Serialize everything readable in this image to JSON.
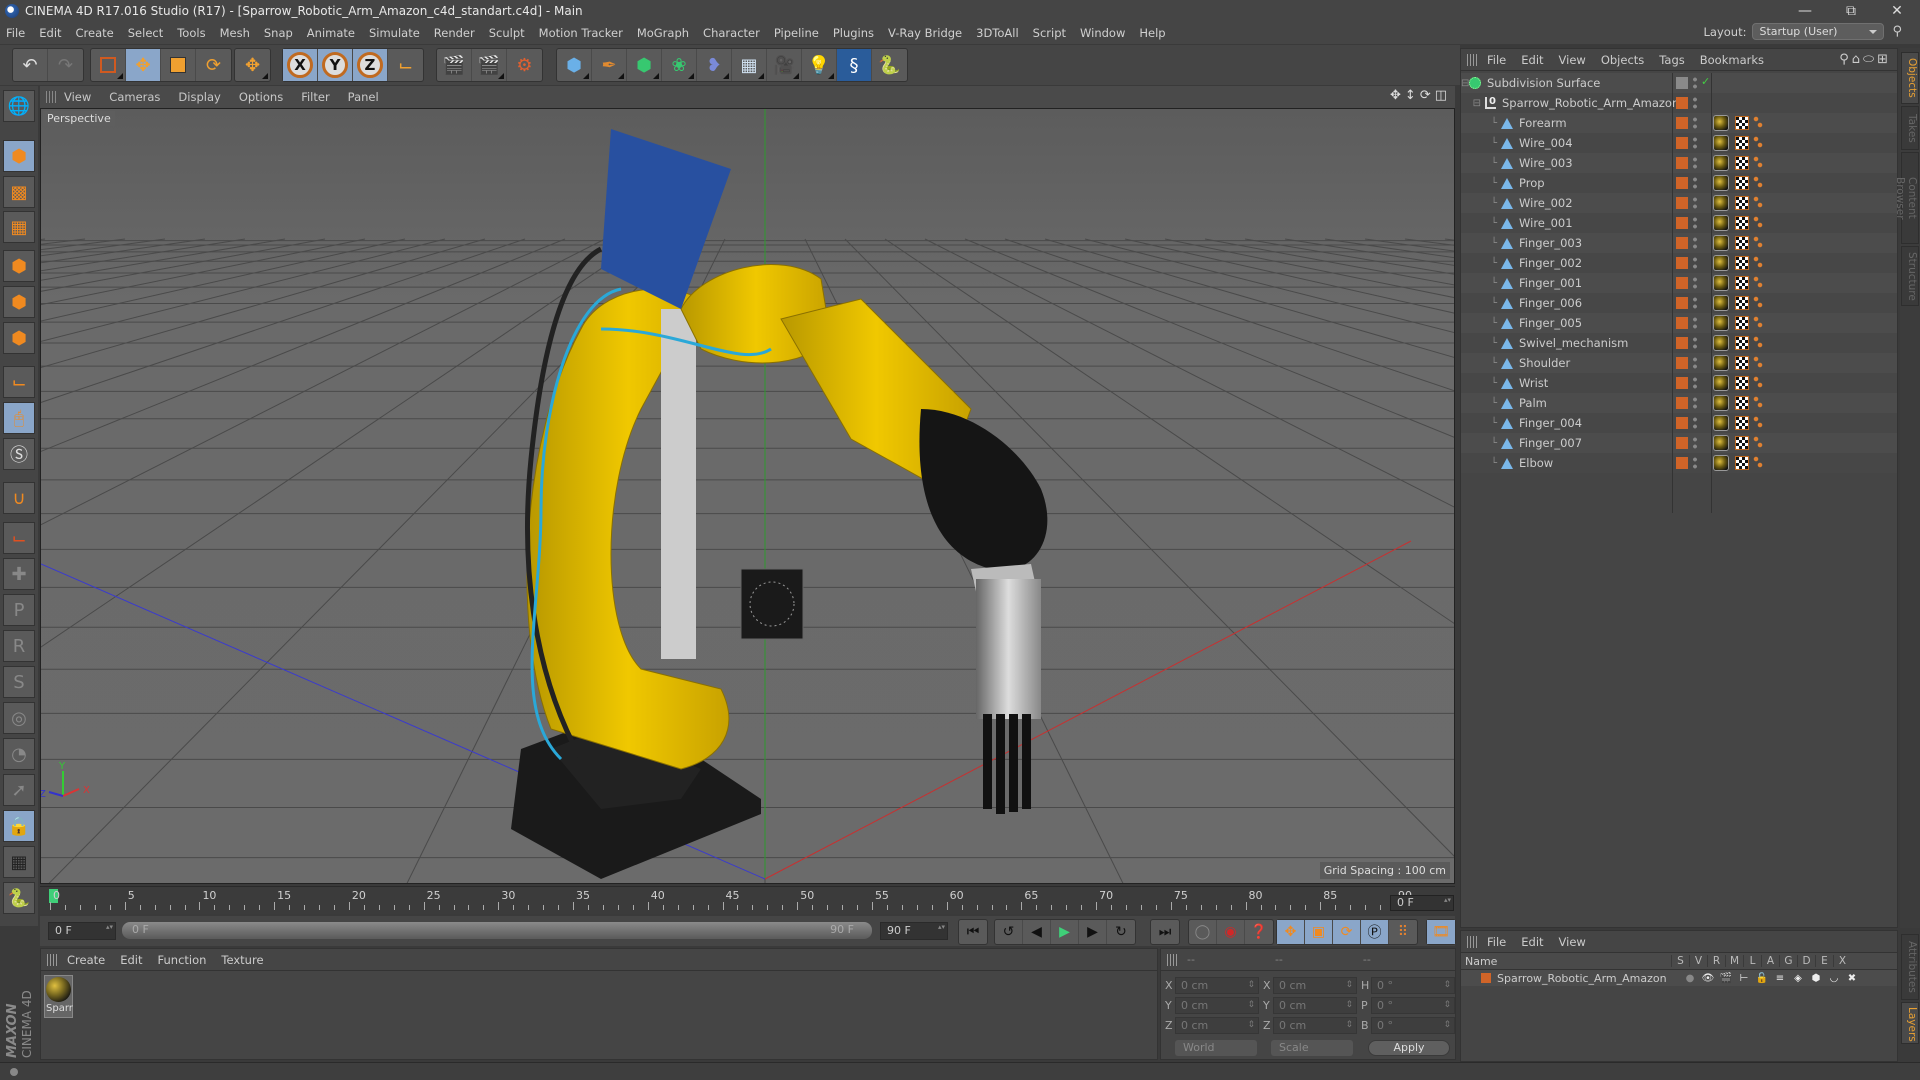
{
  "window": {
    "title": "CINEMA 4D R17.016 Studio (R17) - [Sparrow_Robotic_Arm_Amazon_c4d_standart.c4d] - Main",
    "controls": [
      "minimize",
      "restore",
      "close"
    ]
  },
  "menubar": {
    "items": [
      "File",
      "Edit",
      "Create",
      "Select",
      "Tools",
      "Mesh",
      "Snap",
      "Animate",
      "Simulate",
      "Render",
      "Sculpt",
      "Motion Tracker",
      "MoGraph",
      "Character",
      "Pipeline",
      "Plugins",
      "V-Ray Bridge",
      "3DToAll",
      "Script",
      "Window",
      "Help"
    ],
    "layout_label": "Layout:",
    "layout_value": "Startup (User)"
  },
  "toolbar": {
    "groups": [
      [
        "undo-icon",
        "redo-icon"
      ],
      [
        "live-selection-icon",
        "move-icon",
        "scale-icon",
        "rotate-icon"
      ],
      [
        "recent-tool-icon"
      ],
      [
        "x-axis-lock",
        "y-axis-lock",
        "z-axis-lock",
        "world-coordinates-icon"
      ],
      [
        "render-view-icon",
        "render-picture-viewer-icon",
        "render-settings-icon"
      ],
      [
        "cube-object-icon",
        "pen-spline-icon",
        "subdivision-surface-icon",
        "array-icon",
        "deformer-icon",
        "floor-icon",
        "camera-icon",
        "light-icon",
        "script-icon",
        "python-icon"
      ]
    ],
    "axis_labels": [
      "X",
      "Y",
      "Z"
    ]
  },
  "left_tools": [
    "make-editable-icon",
    "model-mode-icon",
    "texture-mode-icon",
    "workplane-mode-icon",
    "points-mode-icon",
    "edges-mode-icon",
    "polygons-mode-icon",
    "axis-mode-icon",
    "tweak-mode-icon",
    "solo-icon",
    "snap-icon",
    "workplane-icon",
    "add-keyframe-icon",
    "position-key-icon",
    "rotation-key-icon",
    "pla-key-icon",
    "parameter-key-icon",
    "point-level-anim-icon",
    "auto-key-icon",
    "lock-workplane-icon",
    "align-workplane-icon",
    "python-icon"
  ],
  "viewport": {
    "menu": [
      "View",
      "Cameras",
      "Display",
      "Options",
      "Filter",
      "Panel"
    ],
    "camera_label": "Perspective",
    "grid_spacing": "Grid Spacing : 100 cm",
    "axis_labels": {
      "x": "X",
      "y": "Y",
      "z": "Z"
    }
  },
  "timeline": {
    "ticks": [
      0,
      5,
      10,
      15,
      20,
      25,
      30,
      35,
      40,
      45,
      50,
      55,
      60,
      65,
      70,
      75,
      80,
      85,
      90
    ],
    "current_frame_display": "0 F",
    "start_field": "0 F",
    "range_start": "0 F",
    "range_end": "90 F",
    "end_field": "90 F",
    "current_frame": 0,
    "max_frame": 90
  },
  "transport": {
    "buttons": [
      "go-to-start",
      "previous-key",
      "previous-frame",
      "play",
      "next-frame",
      "next-key",
      "go-to-end"
    ],
    "key_buttons": [
      "record-disabled",
      "record-active",
      "autokey-help"
    ],
    "key_filters": [
      "position",
      "scale",
      "rotation",
      "parameter",
      "point-level"
    ],
    "timeline_button": "timeline-icon"
  },
  "material_manager": {
    "menu": [
      "Create",
      "Edit",
      "Function",
      "Texture"
    ],
    "materials": [
      {
        "name": "Sparr"
      }
    ]
  },
  "coordinates": {
    "headers": [
      "--",
      "--",
      "--"
    ],
    "rows": [
      {
        "pos_axis": "X",
        "pos": "0 cm",
        "size_axis": "X",
        "size": "0 cm",
        "rot_axis": "H",
        "rot": "0 °"
      },
      {
        "pos_axis": "Y",
        "pos": "0 cm",
        "size_axis": "Y",
        "size": "0 cm",
        "rot_axis": "P",
        "rot": "0 °"
      },
      {
        "pos_axis": "Z",
        "pos": "0 cm",
        "size_axis": "Z",
        "size": "0 cm",
        "rot_axis": "B",
        "rot": "0 °"
      }
    ],
    "mode_dropdown": "World",
    "size_dropdown": "Scale",
    "apply_label": "Apply"
  },
  "object_manager": {
    "menu": [
      "File",
      "Edit",
      "View",
      "Objects",
      "Tags",
      "Bookmarks"
    ],
    "objects": [
      {
        "name": "Subdivision Surface",
        "type": "subdivision",
        "level": 0
      },
      {
        "name": "Sparrow_Robotic_Arm_Amazon",
        "type": "null",
        "level": 1
      },
      {
        "name": "Forearm",
        "type": "polygon",
        "level": 2
      },
      {
        "name": "Wire_004",
        "type": "polygon",
        "level": 2
      },
      {
        "name": "Wire_003",
        "type": "polygon",
        "level": 2
      },
      {
        "name": "Prop",
        "type": "polygon",
        "level": 2
      },
      {
        "name": "Wire_002",
        "type": "polygon",
        "level": 2
      },
      {
        "name": "Wire_001",
        "type": "polygon",
        "level": 2
      },
      {
        "name": "Finger_003",
        "type": "polygon",
        "level": 2
      },
      {
        "name": "Finger_002",
        "type": "polygon",
        "level": 2
      },
      {
        "name": "Finger_001",
        "type": "polygon",
        "level": 2
      },
      {
        "name": "Finger_006",
        "type": "polygon",
        "level": 2
      },
      {
        "name": "Finger_005",
        "type": "polygon",
        "level": 2
      },
      {
        "name": "Swivel_mechanism",
        "type": "polygon",
        "level": 2
      },
      {
        "name": "Shoulder",
        "type": "polygon",
        "level": 2
      },
      {
        "name": "Wrist",
        "type": "polygon",
        "level": 2
      },
      {
        "name": "Palm",
        "type": "polygon",
        "level": 2
      },
      {
        "name": "Finger_004",
        "type": "polygon",
        "level": 2
      },
      {
        "name": "Finger_007",
        "type": "polygon",
        "level": 2
      },
      {
        "name": "Elbow",
        "type": "polygon",
        "level": 2
      }
    ],
    "side_tabs": [
      "Objects",
      "Takes",
      "Content Browser",
      "Structure"
    ],
    "active_tab": "Objects"
  },
  "layer_manager": {
    "menu": [
      "File",
      "Edit",
      "View"
    ],
    "columns": [
      "Name",
      "S",
      "V",
      "R",
      "M",
      "L",
      "A",
      "G",
      "D",
      "E",
      "X"
    ],
    "layers": [
      {
        "name": "Sparrow_Robotic_Arm_Amazon",
        "color": "#d06428"
      }
    ],
    "side_tabs": [
      "Attributes",
      "Layers"
    ],
    "active_tab": "Layers"
  },
  "branding": {
    "maxon": "MAXON",
    "product": "CINEMA 4D"
  },
  "colors": {
    "accent": "#e8a033",
    "layer_orange": "#d06428",
    "active_blue": "#8aa6c9",
    "playhead_green": "#3fcf78"
  }
}
